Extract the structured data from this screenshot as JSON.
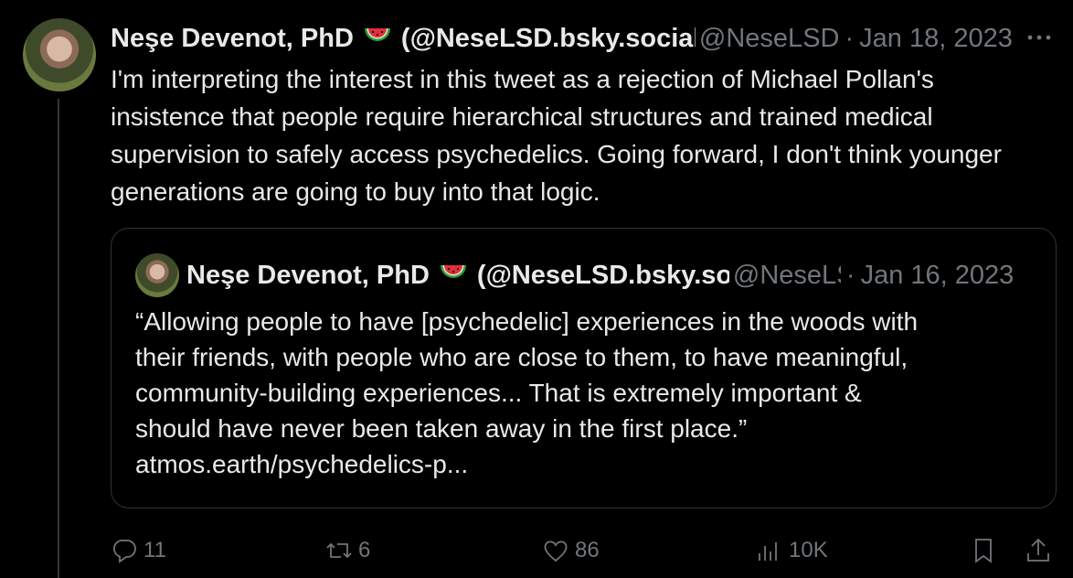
{
  "tweet": {
    "author_name": "Neşe Devenot, PhD",
    "emoji": "watermelon-icon",
    "author_display_handle": "(@NeseLSD.bsky.social)",
    "author_handle": "@NeseLSD",
    "date": "Jan 18, 2023",
    "text": "I'm interpreting the interest in this tweet as a rejection of Michael Pollan's insistence that people require hierarchical structures and trained medical supervision to safely access psychedelics. Going forward, I don't think younger generations are going to buy into that logic."
  },
  "quote": {
    "author_name": "Neşe Devenot, PhD",
    "author_display_handle": "(@NeseLSD.bsky.social)",
    "author_handle": "@NeseLSD",
    "date": "Jan 16, 2023",
    "lines": [
      "“Allowing people to have [psychedelic] experiences in the woods with",
      "their friends, with people who are close to them, to have meaningful,",
      "community-building experiences... That is extremely important &",
      "should have never been taken away in the first place.”",
      "atmos.earth/psychedelics-p..."
    ]
  },
  "actions": {
    "replies": "11",
    "reposts": "6",
    "likes": "86",
    "views": "10K"
  },
  "colors": {
    "background": "#000000",
    "text": "#e7e9ea",
    "muted": "#71767b",
    "border": "#2f3336"
  }
}
